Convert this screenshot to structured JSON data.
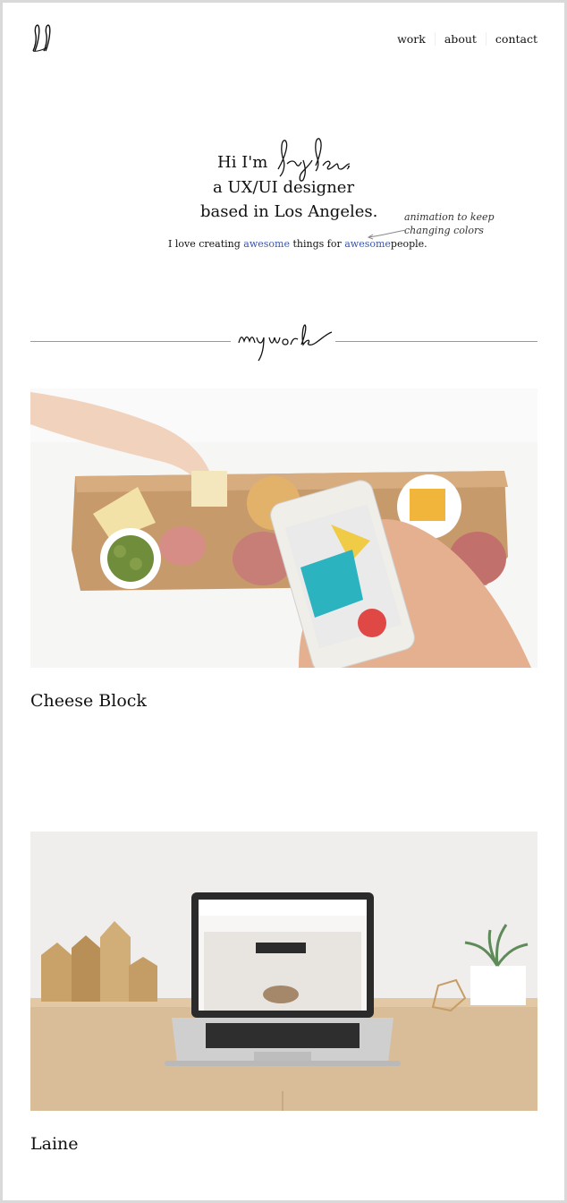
{
  "nav": {
    "items": [
      "work",
      "about",
      "contact"
    ]
  },
  "hero": {
    "greeting": "Hi I'm",
    "comma": ",",
    "line2": "a UX/UI designer",
    "line3": "based in Los Angeles.",
    "tagline_pre": "I love creating",
    "tagline_word1": "awesome",
    "tagline_mid": "things for",
    "tagline_word2": "awesome",
    "tagline_post": "people.",
    "note_line1": "animation to keep",
    "note_line2": "changing colors"
  },
  "projects": [
    {
      "title": "Cheese Block"
    },
    {
      "title": "Laine"
    }
  ],
  "colors": {
    "accent": "#3a56a8",
    "text": "#111111",
    "divider": "#999999"
  }
}
